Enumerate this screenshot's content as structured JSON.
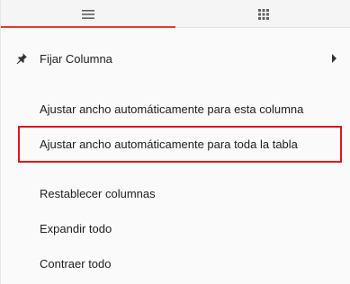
{
  "tabs": [
    {
      "name": "tab-general",
      "icon": "hamburger-menu-icon",
      "active": true
    },
    {
      "name": "tab-columns",
      "icon": "grid-icon",
      "active": false
    }
  ],
  "colors": {
    "accent": "#e53935",
    "highlight": "#e8141b"
  },
  "menu": {
    "items": [
      {
        "label": "Fijar Columna",
        "icon": "pin-icon",
        "submenu": true
      },
      {
        "label": "Ajustar ancho automáticamente para esta columna"
      },
      {
        "label": "Ajustar ancho automáticamente para toda la tabla",
        "highlighted": true
      },
      {
        "label": "Restablecer columnas"
      },
      {
        "label": "Expandir todo"
      },
      {
        "label": "Contraer todo"
      }
    ]
  }
}
